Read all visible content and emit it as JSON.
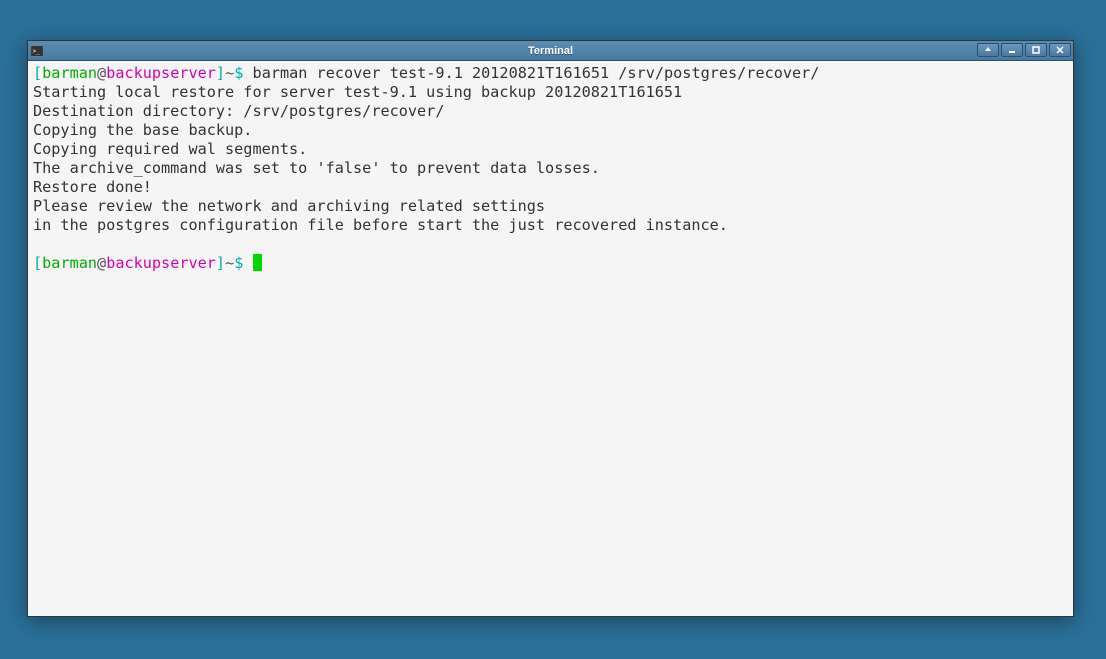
{
  "window": {
    "title": "Terminal"
  },
  "prompt": {
    "open_bracket": "[",
    "user": "barman",
    "at": "@",
    "host": "backupserver",
    "close_bracket": "]",
    "tilde": "~",
    "dollar": "$"
  },
  "command": "barman recover test-9.1 20120821T161651 /srv/postgres/recover/",
  "output": {
    "l1": "Starting local restore for server test-9.1 using backup 20120821T161651",
    "l2": "Destination directory: /srv/postgres/recover/",
    "l3": "Copying the base backup.",
    "l4": "Copying required wal segments.",
    "l5": "The archive_command was set to 'false' to prevent data losses.",
    "l6": "Restore done!",
    "l7": "",
    "l8": "Please review the network and archiving related settings",
    "l9": "in the postgres configuration file before start the just recovered instance."
  }
}
